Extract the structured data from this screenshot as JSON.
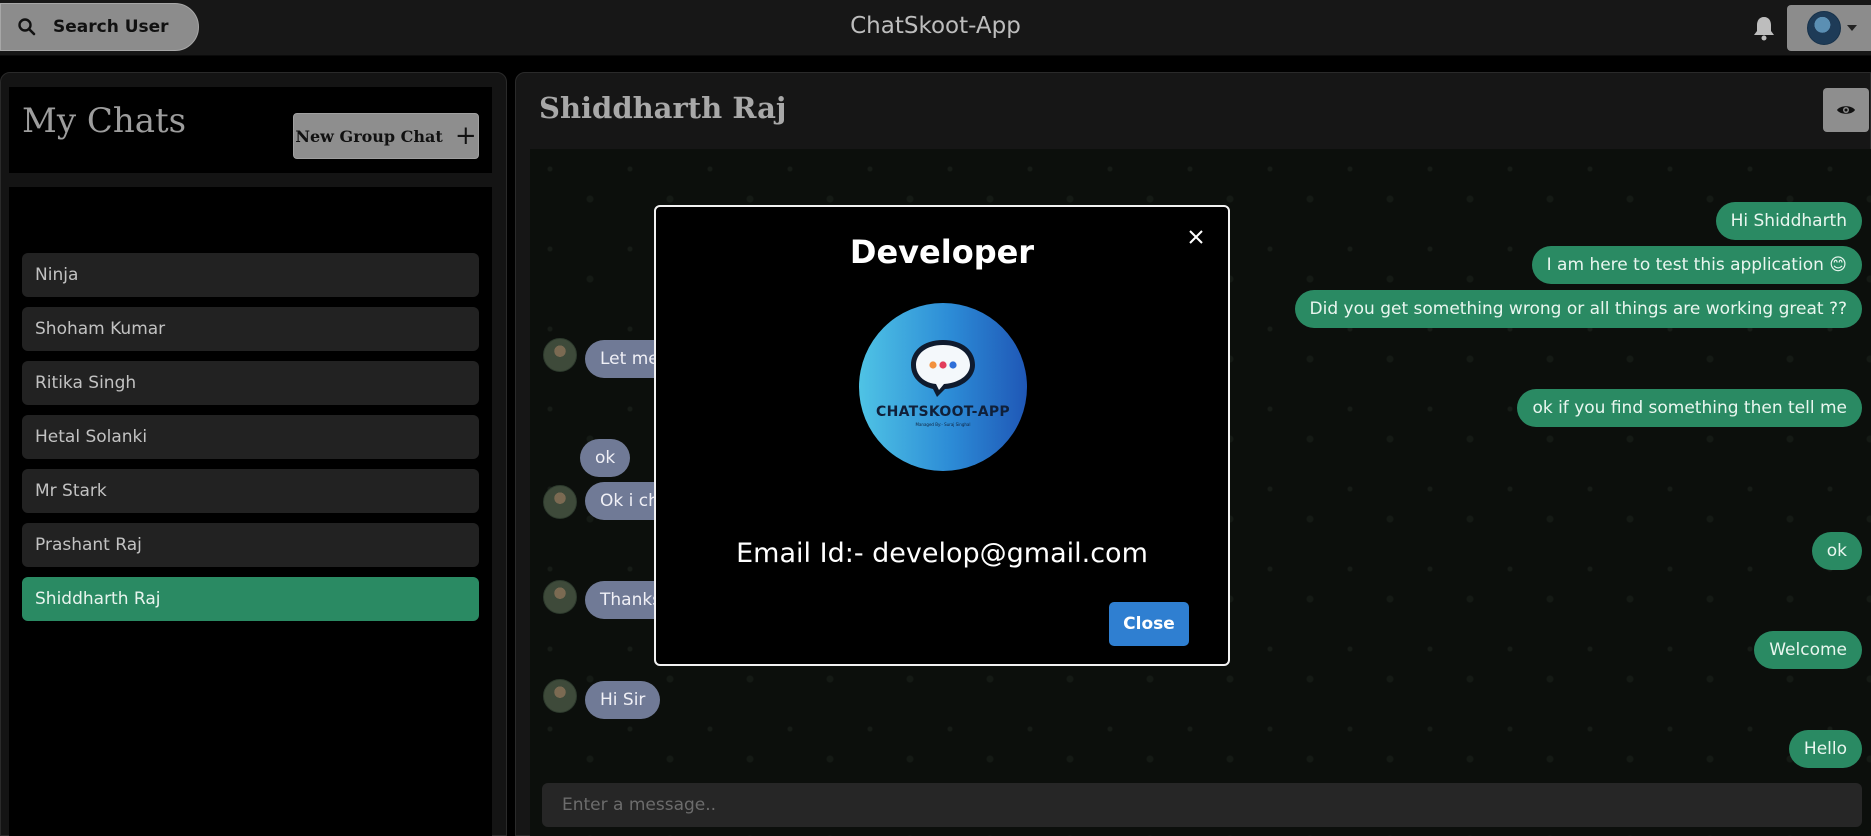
{
  "header": {
    "search_label": "Search User",
    "app_title": "ChatSkoot-App"
  },
  "sidebar": {
    "title": "My Chats",
    "new_group_label": "New Group Chat",
    "new_group_icon": "+",
    "chats": [
      {
        "name": "Ninja",
        "active": false
      },
      {
        "name": "Shoham Kumar",
        "active": false
      },
      {
        "name": "Ritika Singh",
        "active": false
      },
      {
        "name": "Hetal Solanki",
        "active": false
      },
      {
        "name": "Mr Stark",
        "active": false
      },
      {
        "name": "Prashant Raj",
        "active": false
      },
      {
        "name": "Shiddharth Raj",
        "active": true
      }
    ]
  },
  "chat": {
    "title": "Shiddharth Raj",
    "messages_out": [
      "Hi Shiddharth",
      "I am here to test this application 😊",
      "Did you get something wrong or all things are working great ??",
      "ok if you find something then tell me",
      "ok",
      "Welcome",
      "Hello"
    ],
    "messages_in": [
      "Let me",
      "ok",
      "Ok i ch",
      "Thanks",
      "Hi Sir"
    ],
    "input_placeholder": "Enter a message.."
  },
  "modal": {
    "title": "Developer",
    "logo_text": "CHATSKOOT-APP",
    "logo_subtext": "Managed By:- Suraj Singhal",
    "email": "Email Id:- develop@gmail.com",
    "close_label": "Close"
  },
  "colors": {
    "accent_green": "#2a8a63",
    "incoming_bubble": "#707a96",
    "close_button": "#2f7fd1"
  }
}
